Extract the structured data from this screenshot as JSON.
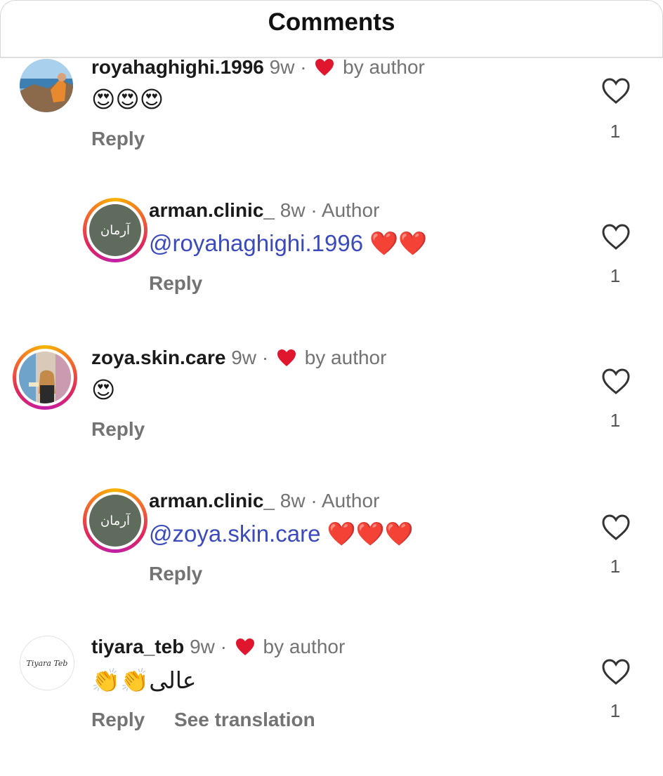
{
  "header": {
    "title": "Comments"
  },
  "comments": [
    {
      "username": "royahaghighi.1996",
      "time": "9w",
      "dot": "·",
      "badge": "by author",
      "text": "😍😍😍",
      "reply_label": "Reply",
      "likes": "1"
    },
    {
      "username": "arman.clinic_",
      "time": "8w",
      "dot": "·",
      "badge": "Author",
      "mention": "@royahaghighi.1996",
      "text": "❤️❤️",
      "reply_label": "Reply",
      "likes": "1",
      "logo_text": "آرمان"
    },
    {
      "username": "zoya.skin.care",
      "time": "9w",
      "dot": "·",
      "badge": "by author",
      "text": "😍",
      "reply_label": "Reply",
      "likes": "1"
    },
    {
      "username": "arman.clinic_",
      "time": "8w",
      "dot": "·",
      "badge": "Author",
      "mention": "@zoya.skin.care",
      "text": "❤️❤️❤️",
      "reply_label": "Reply",
      "likes": "1",
      "logo_text": "آرمان"
    },
    {
      "username": "tiyara_teb",
      "time": "9w",
      "dot": "·",
      "badge": "by author",
      "text": "👏👏عالی",
      "reply_label": "Reply",
      "see_translation": "See translation",
      "likes": "1",
      "logo_text": "Tiyara Teb"
    }
  ],
  "colors": {
    "heart_red": "#e0152e",
    "mention_blue": "#3b4bbd",
    "meta_gray": "#737373"
  }
}
